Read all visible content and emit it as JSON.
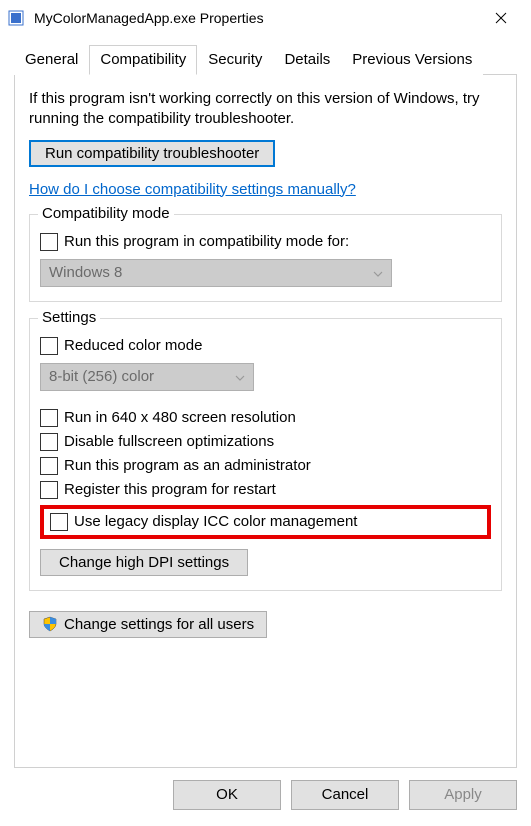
{
  "window": {
    "title": "MyColorManagedApp.exe Properties"
  },
  "tabs": {
    "general": "General",
    "compatibility": "Compatibility",
    "security": "Security",
    "details": "Details",
    "previous_versions": "Previous Versions"
  },
  "panel": {
    "intro": "If this program isn't working correctly on this version of Windows, try running the compatibility troubleshooter.",
    "troubleshoot_btn": "Run compatibility troubleshooter",
    "help_link": "How do I choose compatibility settings manually?",
    "compat_mode": {
      "legend": "Compatibility mode",
      "checkbox_label": "Run this program in compatibility mode for:",
      "select_value": "Windows 8"
    },
    "settings": {
      "legend": "Settings",
      "reduced_color": "Reduced color mode",
      "color_select": "8-bit (256) color",
      "run_640": "Run in 640 x 480 screen resolution",
      "disable_fullscreen": "Disable fullscreen optimizations",
      "run_admin": "Run this program as an administrator",
      "register_restart": "Register this program for restart",
      "legacy_icc": "Use legacy display ICC color management",
      "dpi_btn": "Change high DPI settings"
    },
    "all_users_btn": "Change settings for all users"
  },
  "footer": {
    "ok": "OK",
    "cancel": "Cancel",
    "apply": "Apply"
  }
}
